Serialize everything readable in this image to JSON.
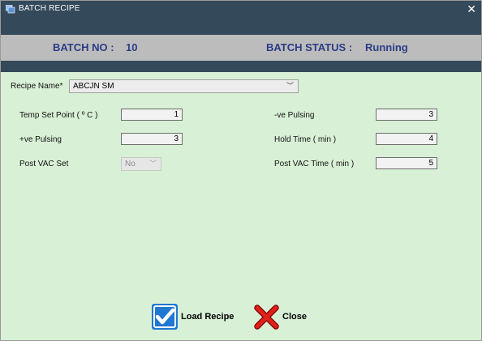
{
  "window": {
    "title": "BATCH RECIPE",
    "close_glyph": "✕"
  },
  "header": {
    "batch_no_label": "BATCH NO :",
    "batch_no_value": "10",
    "batch_status_label": "BATCH STATUS :",
    "batch_status_value": "Running",
    "text_color": "#2b3c86"
  },
  "recipe": {
    "label": "Recipe Name*",
    "selected": "ABCJN SM"
  },
  "fields": {
    "temp_set_point": {
      "label": "Temp Set Point ( º C )",
      "value": "1"
    },
    "pos_pulsing": {
      "label": "+ve Pulsing",
      "value": "3"
    },
    "post_vac_set": {
      "label": "Post VAC Set",
      "value": "No"
    },
    "neg_pulsing": {
      "label": "-ve Pulsing",
      "value": "3"
    },
    "hold_time": {
      "label": "Hold Time ( min )",
      "value": "4"
    },
    "post_vac_time": {
      "label": "Post VAC Time ( min )",
      "value": "5"
    }
  },
  "buttons": {
    "load": {
      "label": "Load Recipe",
      "icon": "checkmark-icon"
    },
    "close": {
      "label": "Close",
      "icon": "red-x-icon"
    }
  },
  "colors": {
    "titlebar": "#34495a",
    "background": "#d8f0d6",
    "info_strip": "#bcbcbc"
  }
}
